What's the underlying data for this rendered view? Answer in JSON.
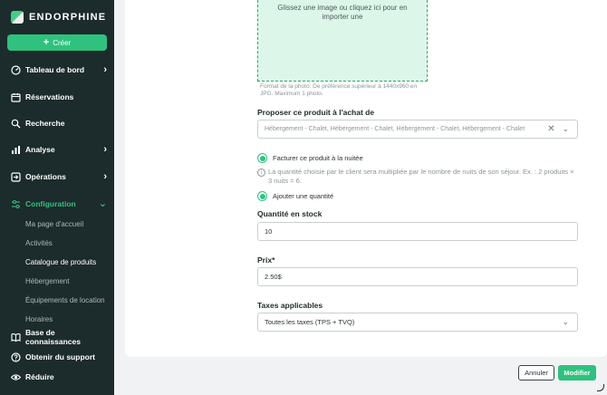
{
  "brand": {
    "name": "ENDORPHINE"
  },
  "sidebar": {
    "create_label": "Créer",
    "items": [
      {
        "label": "Tableau de bord",
        "icon": "dashboard-icon",
        "chevron": "right"
      },
      {
        "label": "Réservations",
        "icon": "calendar-icon"
      },
      {
        "label": "Recherche",
        "icon": "search-icon"
      },
      {
        "label": "Analyse",
        "icon": "bar-chart-icon",
        "chevron": "right"
      },
      {
        "label": "Opérations",
        "icon": "arrow-box-icon",
        "chevron": "right"
      },
      {
        "label": "Configuration",
        "icon": "sliders-icon",
        "chevron": "down"
      }
    ],
    "sub_items": [
      "Ma page d'accueil",
      "Activités",
      "Catalogue de produits",
      "Hébergement",
      "Équipements de location",
      "Horaires"
    ],
    "bottom_items": [
      {
        "label": "Base de connaissances",
        "icon": "book-icon"
      },
      {
        "label": "Obtenir du support",
        "icon": "help-icon"
      },
      {
        "label": "Réduire",
        "icon": "eye-icon"
      }
    ]
  },
  "form": {
    "dropzone_text": "Glissez une image ou cliquez ici pour en importer une",
    "photo_hint": "Format de la photo: De préférence supérieur à 1440x960 en JPG. Maximum 1 photo.",
    "propose_label": "Proposer ce produit à l'achat de",
    "propose_value": "Hébergement - Chalet, Hébergement - Chalet, Hébergement - Chalet, Hébergement - Chalet",
    "night_option_label": "Facturer ce produit à la nuitée",
    "night_info": "La quantité choisie par le client sera multipliée par le nombre de nuits de son séjour. Ex. : 2 produits × 3 nuits = 6.",
    "add_quantity_label": "Ajouter une quantité",
    "stock_label": "Quantité en stock",
    "stock_value": "10",
    "price_label": "Prix*",
    "price_value": "2.50$",
    "taxes_label": "Taxes applicables",
    "taxes_value": "Toutes les taxes (TPS + TVQ)"
  },
  "actions": {
    "cancel_label": "Annuler",
    "save_label": "Modifier"
  },
  "colors": {
    "sidebar_bg": "#1c2b2b",
    "accent": "#2ec27e",
    "dropzone_bg": "#dcf7ea"
  }
}
